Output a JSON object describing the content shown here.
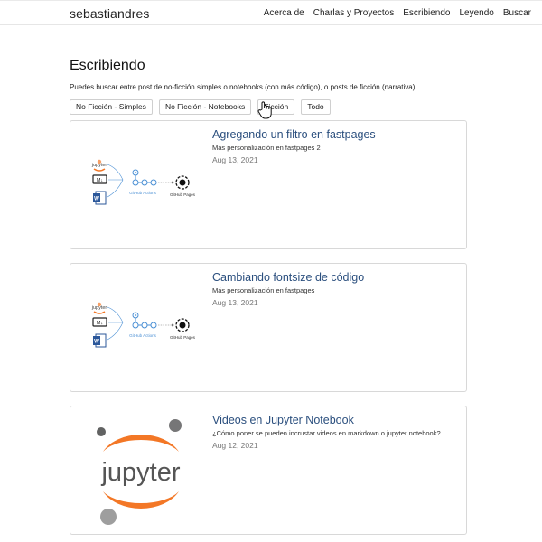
{
  "site": {
    "brand": "sebastiandres",
    "nav": [
      "Acerca de",
      "Charlas y Proyectos",
      "Escribiendo",
      "Leyendo",
      "Buscar"
    ]
  },
  "page": {
    "title": "Escribiendo",
    "intro": "Puedes buscar entre post de no-ficción simples o notebooks (con más código), o posts de ficción (narrativa)."
  },
  "filters": [
    "No Ficción - Simples",
    "No Ficción - Notebooks",
    "Ficción",
    "Todo"
  ],
  "posts": [
    {
      "title": "Agregando un filtro en fastpages",
      "subtitle": "Más personalización en fastpages 2",
      "date": "Aug 13, 2021",
      "thumb": {
        "type": "fastpages-diagram",
        "labels": [
          "jupyter",
          "GitHub Actions",
          "GitHub Pages"
        ]
      }
    },
    {
      "title": "Cambiando fontsize de código",
      "subtitle": "Más personalización en fastpages",
      "date": "Aug 13, 2021",
      "thumb": {
        "type": "fastpages-diagram",
        "labels": [
          "jupyter",
          "GitHub Actions",
          "GitHub Pages"
        ]
      }
    },
    {
      "title": "Videos en Jupyter Notebook",
      "subtitle": "¿Cómo poner se pueden incrustar videos en markdown o jupyter notebook?",
      "date": "Aug 12, 2021",
      "thumb": {
        "type": "jupyter-logo",
        "labels": [
          "jupyter"
        ]
      }
    }
  ],
  "colors": {
    "link": "#2b4f7e",
    "jupyter_orange": "#f37726",
    "gh_blue": "#4a8fd4",
    "word_blue": "#2b579a"
  }
}
